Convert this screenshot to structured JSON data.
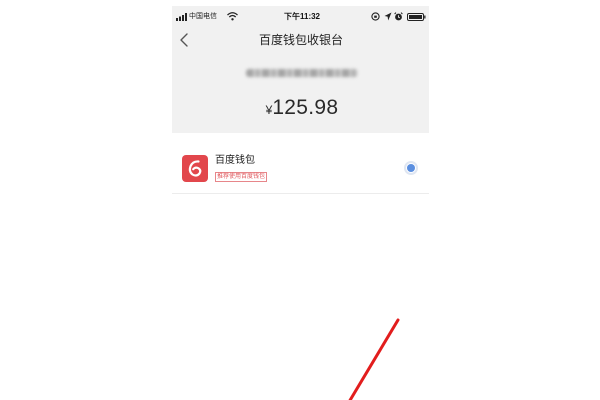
{
  "status_bar": {
    "carrier": "中国电信",
    "time": "下午11:32",
    "icons": [
      "signal-icon",
      "wifi-icon",
      "rotation-lock-icon",
      "location-icon",
      "alarm-icon",
      "battery-icon"
    ]
  },
  "header": {
    "title": "百度钱包收银台",
    "back_icon": "chevron-left-icon"
  },
  "order": {
    "currency_symbol": "¥",
    "amount": "125.98"
  },
  "payment_methods": [
    {
      "name": "百度钱包",
      "tag": "推荐使用百度钱包",
      "icon": "baidu-wallet-logo",
      "selected": true
    }
  ],
  "colors": {
    "header_bg": "#f1f1f1",
    "logo_red": "#e2474c",
    "tag_red": "#e0575c",
    "radio_blue": "#5b8fe0",
    "annotation_red": "#e21d1d"
  }
}
